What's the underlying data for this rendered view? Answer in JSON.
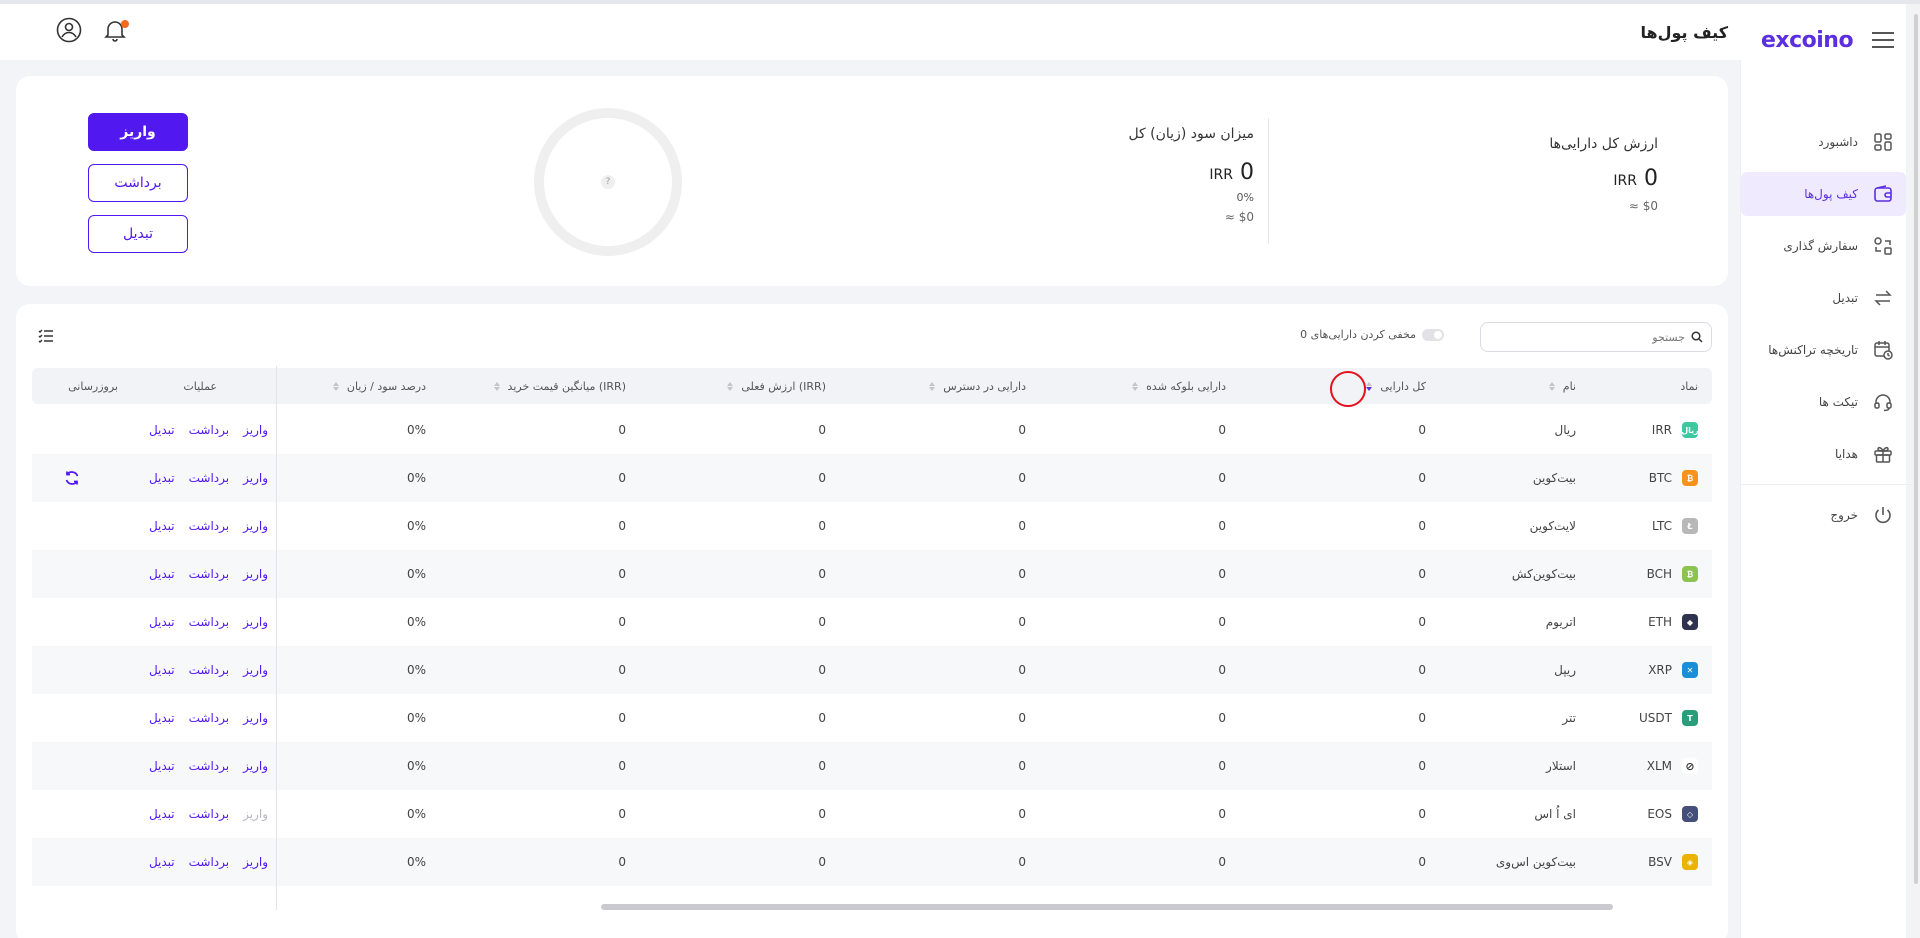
{
  "brand": "excoino",
  "header": {
    "title": "کیف پول‌ها"
  },
  "sidebar": {
    "items": [
      {
        "label": "داشبورد",
        "icon": "dashboard-icon"
      },
      {
        "label": "کیف پول‌ها",
        "icon": "wallet-icon",
        "active": true
      },
      {
        "label": "سفارش گذاری",
        "icon": "order-icon"
      },
      {
        "label": "تبدیل",
        "icon": "convert-icon"
      },
      {
        "label": "تاریخچه تراکنش‌ها",
        "icon": "history-icon"
      },
      {
        "label": "تیکت ها",
        "icon": "headset-icon"
      },
      {
        "label": "هدایا",
        "icon": "gift-icon"
      }
    ],
    "logout": "خروج"
  },
  "summary": {
    "assets_title": "ارزش کل دارایی‌ها",
    "assets_value": "0",
    "assets_unit": "IRR",
    "assets_usd": "≈ $0",
    "profit_title": "میزان سود (زیان) کل",
    "profit_value": "0",
    "profit_unit": "IRR",
    "profit_pct": "0%",
    "profit_usd": "≈ $0",
    "donut_placeholder": "?",
    "buttons": {
      "deposit": "واریز",
      "withdraw": "برداشت",
      "convert": "تبدیل"
    }
  },
  "table": {
    "search_placeholder": "جستجو",
    "hide_label": "مخفی کردن دارایی‌های 0",
    "columns": {
      "symbol": "نماد",
      "name": "نام",
      "total": "کل دارایی",
      "blocked": "دارایی بلوکه شده",
      "available": "دارایی در دسترس",
      "value": "ارزش فعلی (IRR)",
      "avg_price": "میانگین قیمت خرید (IRR)",
      "pnl_pct": "درصد سود / زیان",
      "ops": "عملیات",
      "update": "بروزرسانی"
    },
    "rows": [
      {
        "symbol": "IRR",
        "name": "ریال",
        "total": "0",
        "blocked": "0",
        "available": "0",
        "value": "0",
        "avg": "0",
        "pct": "0%",
        "color": "#3cc9a0",
        "glyph": "ریال",
        "deposit_enabled": true,
        "refresh": false
      },
      {
        "symbol": "BTC",
        "name": "بیت‌کوین",
        "total": "0",
        "blocked": "0",
        "available": "0",
        "value": "0",
        "avg": "0",
        "pct": "0%",
        "color": "#f7931a",
        "glyph": "₿",
        "deposit_enabled": true,
        "refresh": true
      },
      {
        "symbol": "LTC",
        "name": "لایت‌کوین",
        "total": "0",
        "blocked": "0",
        "available": "0",
        "value": "0",
        "avg": "0",
        "pct": "0%",
        "color": "#b8b8b8",
        "glyph": "Ł",
        "deposit_enabled": true,
        "refresh": false
      },
      {
        "symbol": "BCH",
        "name": "بیت‌کوین‌کش",
        "total": "0",
        "blocked": "0",
        "available": "0",
        "value": "0",
        "avg": "0",
        "pct": "0%",
        "color": "#8dc351",
        "glyph": "₿",
        "deposit_enabled": true,
        "refresh": false
      },
      {
        "symbol": "ETH",
        "name": "اتریوم",
        "total": "0",
        "blocked": "0",
        "available": "0",
        "value": "0",
        "avg": "0",
        "pct": "0%",
        "color": "#2f3350",
        "glyph": "◆",
        "deposit_enabled": true,
        "refresh": false
      },
      {
        "symbol": "XRP",
        "name": "ریپل",
        "total": "0",
        "blocked": "0",
        "available": "0",
        "value": "0",
        "avg": "0",
        "pct": "0%",
        "color": "#1a8fd8",
        "glyph": "✕",
        "deposit_enabled": true,
        "refresh": false
      },
      {
        "symbol": "USDT",
        "name": "تتر",
        "total": "0",
        "blocked": "0",
        "available": "0",
        "value": "0",
        "avg": "0",
        "pct": "0%",
        "color": "#2a9d7a",
        "glyph": "T",
        "deposit_enabled": true,
        "refresh": false
      },
      {
        "symbol": "XLM",
        "name": "استلار",
        "total": "0",
        "blocked": "0",
        "available": "0",
        "value": "0",
        "avg": "0",
        "pct": "0%",
        "color": "#ffffff",
        "glyph": "⊘",
        "deposit_enabled": true,
        "refresh": false
      },
      {
        "symbol": "EOS",
        "name": "ای اُ اس",
        "total": "0",
        "blocked": "0",
        "available": "0",
        "value": "0",
        "avg": "0",
        "pct": "0%",
        "color": "#44507a",
        "glyph": "◇",
        "deposit_enabled": false,
        "refresh": false
      },
      {
        "symbol": "BSV",
        "name": "بیت‌کوین اس‌وی",
        "total": "0",
        "blocked": "0",
        "available": "0",
        "value": "0",
        "avg": "0",
        "pct": "0%",
        "color": "#eab300",
        "glyph": "◈",
        "deposit_enabled": true,
        "refresh": false
      }
    ],
    "actions": {
      "deposit": "واریز",
      "withdraw": "برداشت",
      "convert": "تبدیل"
    }
  },
  "colors": {
    "accent": "#5218f0",
    "brand": "#5b2fe0",
    "notification": "#f26b1d",
    "highlight_ring": "#e4101c"
  }
}
